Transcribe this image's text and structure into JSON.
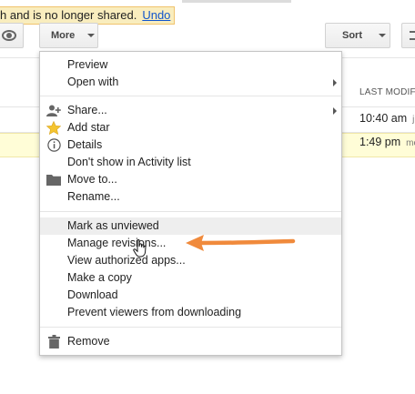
{
  "notice": {
    "message": "h and is no longer shared.",
    "undo_label": "Undo"
  },
  "toolbar": {
    "more_label": "More",
    "sort_label": "Sort"
  },
  "file_list": {
    "column_header": "LAST MODIFIED",
    "rows": [
      {
        "time": "10:40 am",
        "owner": "j"
      },
      {
        "time": "1:49 pm",
        "owner": "me"
      }
    ]
  },
  "menu": {
    "groups": [
      [
        {
          "label": "Preview",
          "submenu": false,
          "icon": ""
        },
        {
          "label": "Open with",
          "submenu": true,
          "icon": ""
        }
      ],
      [
        {
          "label": "Share...",
          "submenu": true,
          "icon": "share-person-icon"
        },
        {
          "label": "Add star",
          "submenu": false,
          "icon": "star-icon"
        },
        {
          "label": "Details",
          "submenu": false,
          "icon": "info-icon"
        },
        {
          "label": "Don't show in Activity list",
          "submenu": false,
          "icon": ""
        },
        {
          "label": "Move to...",
          "submenu": false,
          "icon": "folder-icon"
        },
        {
          "label": "Rename...",
          "submenu": false,
          "icon": ""
        }
      ],
      [
        {
          "label": "Mark as unviewed",
          "submenu": false,
          "icon": "",
          "hovered": true
        },
        {
          "label": "Manage revisions...",
          "submenu": false,
          "icon": ""
        },
        {
          "label": "View authorized apps...",
          "submenu": false,
          "icon": ""
        },
        {
          "label": "Make a copy",
          "submenu": false,
          "icon": ""
        },
        {
          "label": "Download",
          "submenu": false,
          "icon": ""
        },
        {
          "label": "Prevent viewers from downloading",
          "submenu": false,
          "icon": ""
        }
      ],
      [
        {
          "label": "Remove",
          "submenu": false,
          "icon": "trash-icon"
        }
      ]
    ]
  },
  "colors": {
    "annotation_arrow": "#f08a3c",
    "star": "#f4c430",
    "notice_bg": "#f9edbe",
    "link": "#1155cc"
  }
}
